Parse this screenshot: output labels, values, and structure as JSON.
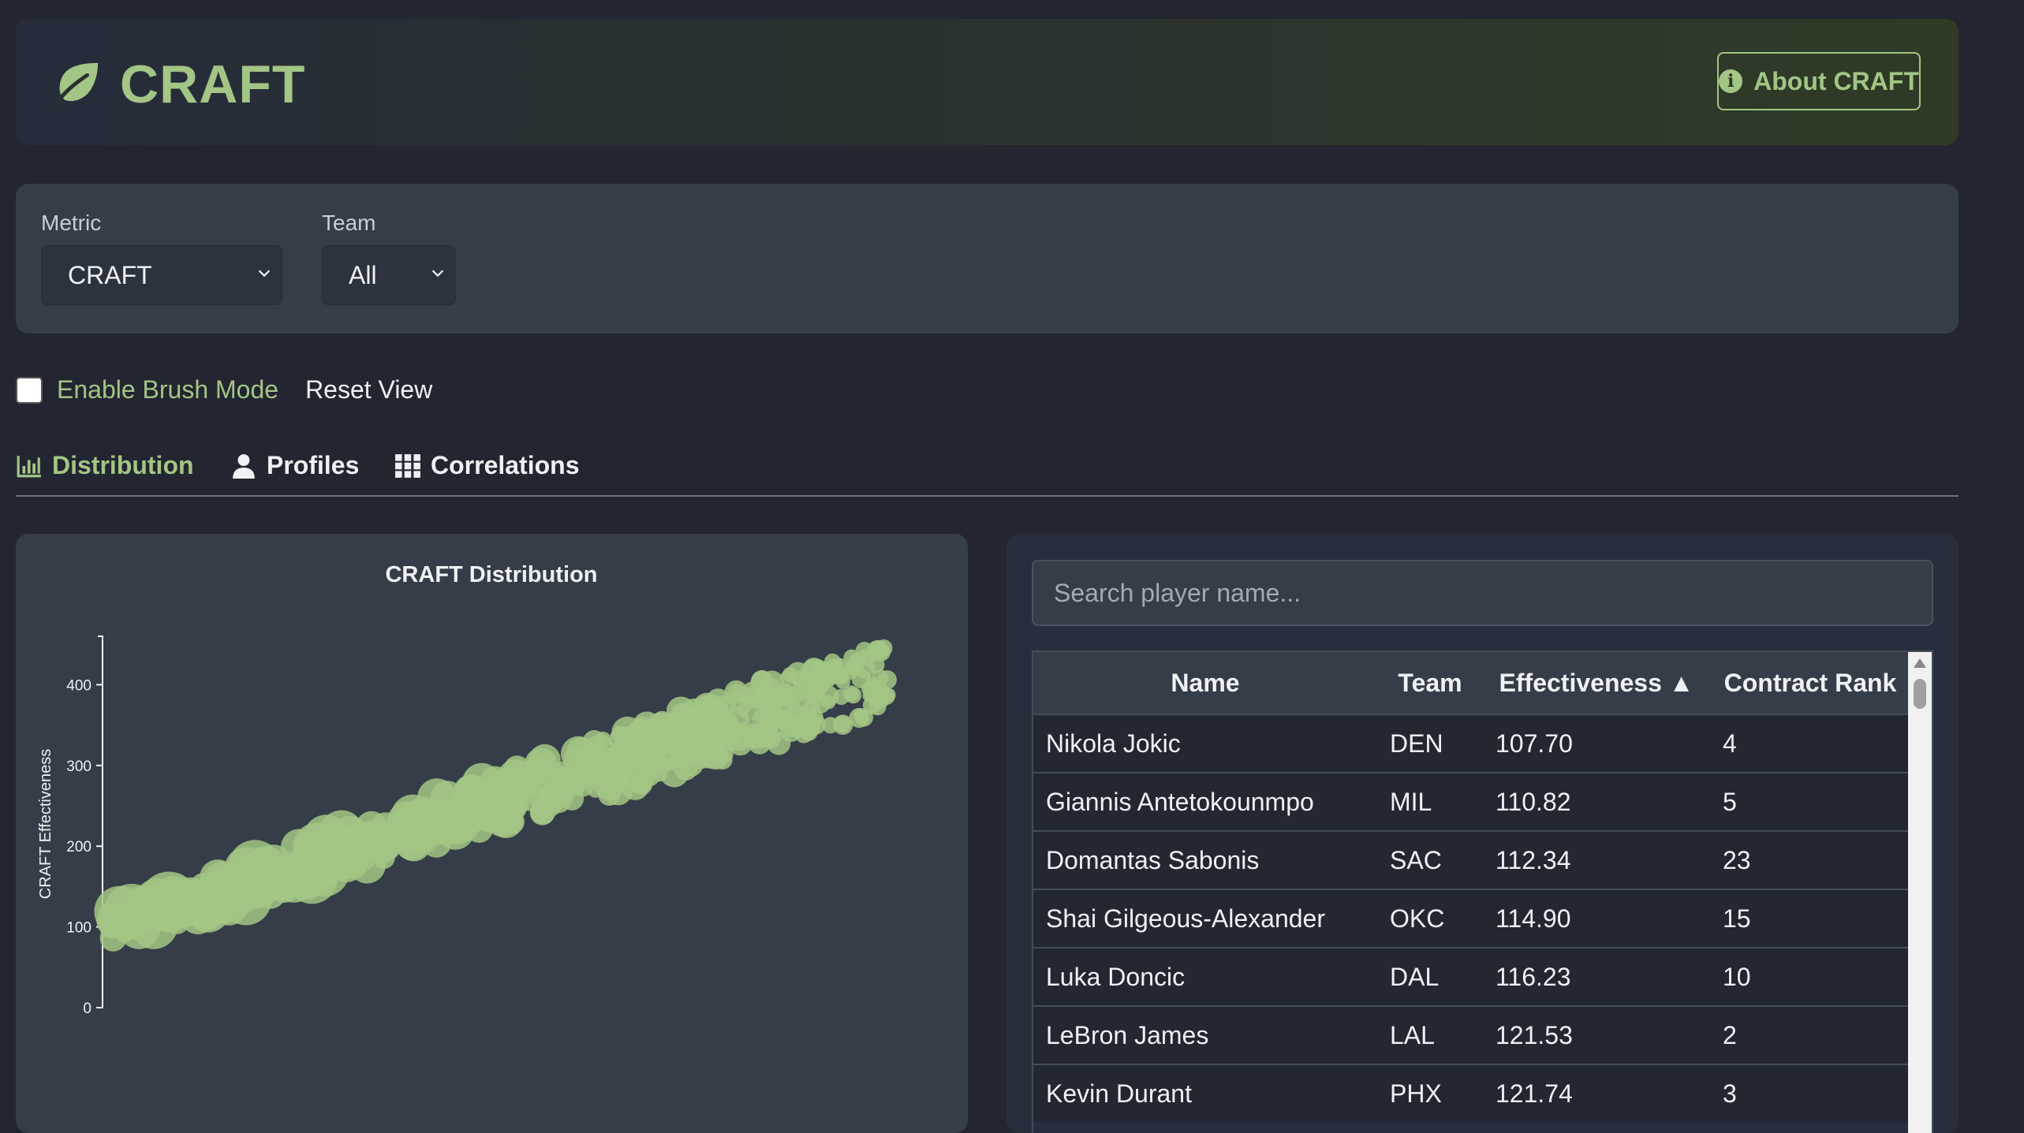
{
  "header": {
    "title": "CRAFT",
    "about_label": "About CRAFT",
    "accent": "#a3c585"
  },
  "filters": {
    "metric_label": "Metric",
    "metric_value": "CRAFT",
    "team_label": "Team",
    "team_value": "All"
  },
  "controls": {
    "brush_label": "Enable Brush Mode",
    "brush_checked": false,
    "reset_label": "Reset View"
  },
  "tabs": [
    {
      "label": "Distribution",
      "icon": "bar-chart-icon",
      "active": true
    },
    {
      "label": "Profiles",
      "icon": "user-icon",
      "active": false
    },
    {
      "label": "Correlations",
      "icon": "grid-icon",
      "active": false
    }
  ],
  "chart_data": {
    "type": "scatter",
    "title": "CRAFT Distribution",
    "ylabel": "CRAFT Effectiveness",
    "xlabel": "",
    "ylim": [
      0,
      460
    ],
    "yticks": [
      0,
      100,
      200,
      300,
      400
    ],
    "color": "#a3c585",
    "point_count_estimate": 450,
    "trend": {
      "y_start": 100,
      "y_end": 420
    }
  },
  "table": {
    "search_placeholder": "Search player name...",
    "columns": [
      "Name",
      "Team",
      "Effectiveness ▲",
      "Contract Rank"
    ],
    "rows": [
      [
        "Nikola Jokic",
        "DEN",
        "107.70",
        "4"
      ],
      [
        "Giannis Antetokounmpo",
        "MIL",
        "110.82",
        "5"
      ],
      [
        "Domantas Sabonis",
        "SAC",
        "112.34",
        "23"
      ],
      [
        "Shai Gilgeous-Alexander",
        "OKC",
        "114.90",
        "15"
      ],
      [
        "Luka Doncic",
        "DAL",
        "116.23",
        "10"
      ],
      [
        "LeBron James",
        "LAL",
        "121.53",
        "2"
      ],
      [
        "Kevin Durant",
        "PHX",
        "121.74",
        "3"
      ]
    ]
  }
}
